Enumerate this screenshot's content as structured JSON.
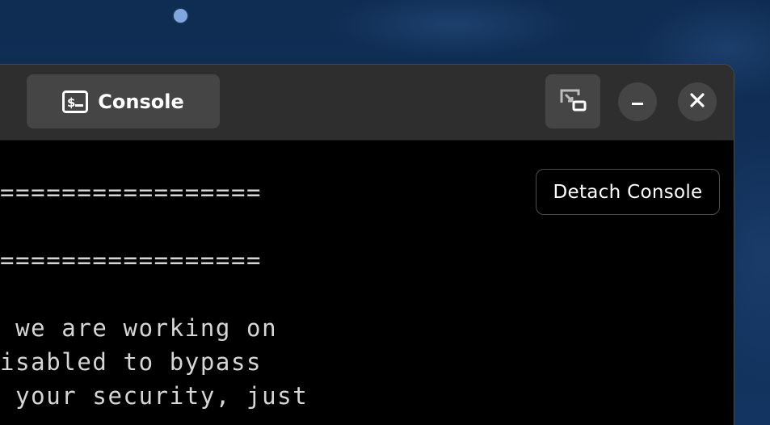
{
  "desktop": {
    "background_color": "#0f2c52"
  },
  "window": {
    "tab": {
      "label": "Console",
      "icon": "terminal-icon"
    },
    "controls": {
      "detach_icon": "detach-window-icon",
      "minimize_icon": "minimize-icon",
      "close_icon": "close-icon"
    }
  },
  "tooltip": {
    "text": "Detach Console"
  },
  "terminal": {
    "lines": [
      "==================",
      "==================",
      "d we are working on",
      "disabled to bypass",
      "t your security, just"
    ],
    "text_color": "#d6d6d6",
    "background_color": "#000000"
  },
  "colors": {
    "titlebar": "#2e2e2e",
    "button": "#454545",
    "text": "#ffffff"
  }
}
